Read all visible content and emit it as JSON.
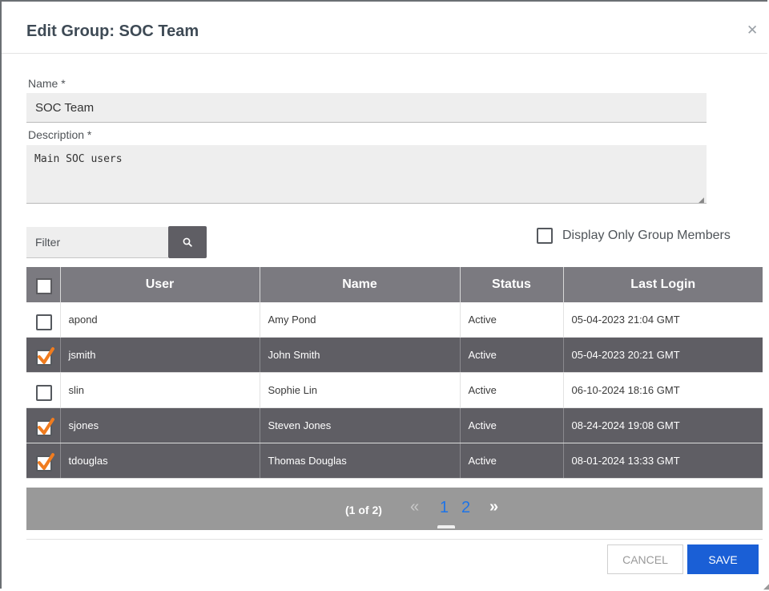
{
  "modal": {
    "title": "Edit Group: SOC Team",
    "close_icon": "close-icon"
  },
  "form": {
    "name_label": "Name *",
    "name_value": "SOC Team",
    "description_label": "Description *",
    "description_value": "Main SOC users"
  },
  "filter": {
    "placeholder": "Filter",
    "search_icon": "search-icon",
    "display_only_members_label": "Display Only Group Members"
  },
  "table": {
    "columns": [
      "User",
      "Name",
      "Status",
      "Last Login"
    ],
    "rows": [
      {
        "user": "apond",
        "name": "Amy Pond",
        "status": "Active",
        "last_login": "05-04-2023 21:04 GMT",
        "selected": false
      },
      {
        "user": "jsmith",
        "name": "John Smith",
        "status": "Active",
        "last_login": "05-04-2023 20:21 GMT",
        "selected": true
      },
      {
        "user": "slin",
        "name": "Sophie Lin",
        "status": "Active",
        "last_login": "06-10-2024 18:16 GMT",
        "selected": false
      },
      {
        "user": "sjones",
        "name": "Steven Jones",
        "status": "Active",
        "last_login": "08-24-2024 19:08 GMT",
        "selected": true
      },
      {
        "user": "tdouglas",
        "name": "Thomas Douglas",
        "status": "Active",
        "last_login": "08-01-2024 13:33 GMT",
        "selected": true
      }
    ]
  },
  "pagination": {
    "summary": "(1 of 2)",
    "prev": "«",
    "page1": "1",
    "page2": "2",
    "next": "»",
    "current_page": 1
  },
  "buttons": {
    "cancel": "CANCEL",
    "save": "SAVE"
  },
  "colors": {
    "header_bg": "#7b7a80",
    "selected_row_bg": "#5f5e64",
    "checkmark": "#f07c1f",
    "save_bg": "#1a5fd6",
    "page_link": "#1d74e8"
  }
}
